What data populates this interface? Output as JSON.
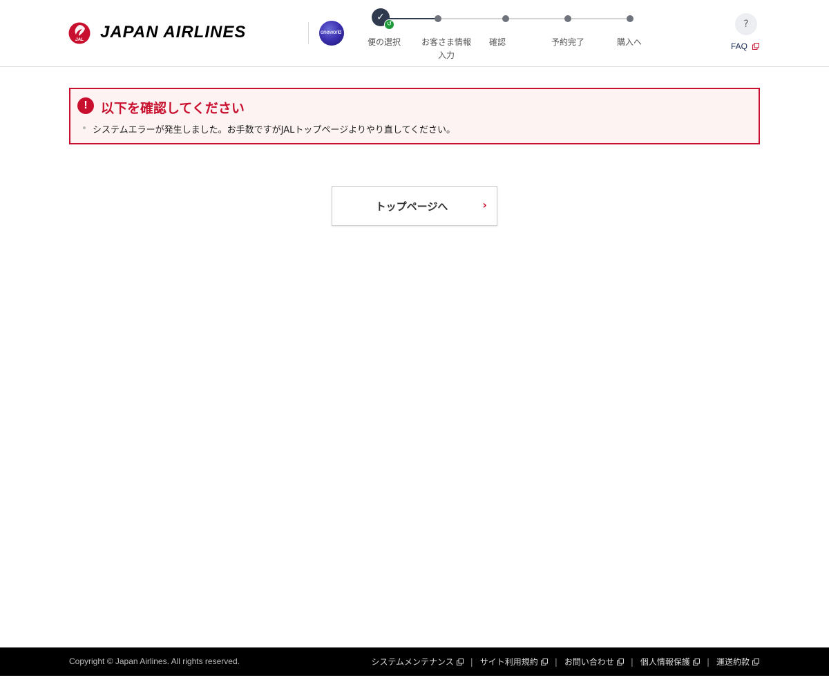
{
  "header": {
    "brand_name": "JAPAN AIRLINES",
    "jal_mark_text": "JAL",
    "alliance_logo_text": "oneworld",
    "help_icon_glyph": "?",
    "faq_label": "FAQ"
  },
  "stepper": {
    "current_index": 0,
    "steps": [
      {
        "label": "便の選択",
        "state": "completed"
      },
      {
        "label": "お客さま情報\n入力",
        "state": "pending"
      },
      {
        "label": "確認",
        "state": "pending"
      },
      {
        "label": "予約完了",
        "state": "pending"
      },
      {
        "label": "購入へ",
        "state": "pending"
      }
    ]
  },
  "alert": {
    "icon_glyph": "!",
    "title": "以下を確認してください",
    "message": "システムエラーが発生しました。お手数ですがJALトップページよりやり直してください。"
  },
  "main": {
    "top_button_label": "トップページへ",
    "top_button_chevron": "›"
  },
  "footer": {
    "copyright": "Copyright © Japan Airlines. All rights reserved.",
    "links": [
      "システムメンテナンス",
      "サイト利用規約",
      "お問い合わせ",
      "個人情報保護",
      "運送約款"
    ]
  },
  "colors": {
    "brand_red": "#c8102e",
    "stepper_active": "#2f3a4f",
    "success_green": "#1f9a3a",
    "alert_bg": "#fdf3f3",
    "footer_bg": "#000000"
  }
}
